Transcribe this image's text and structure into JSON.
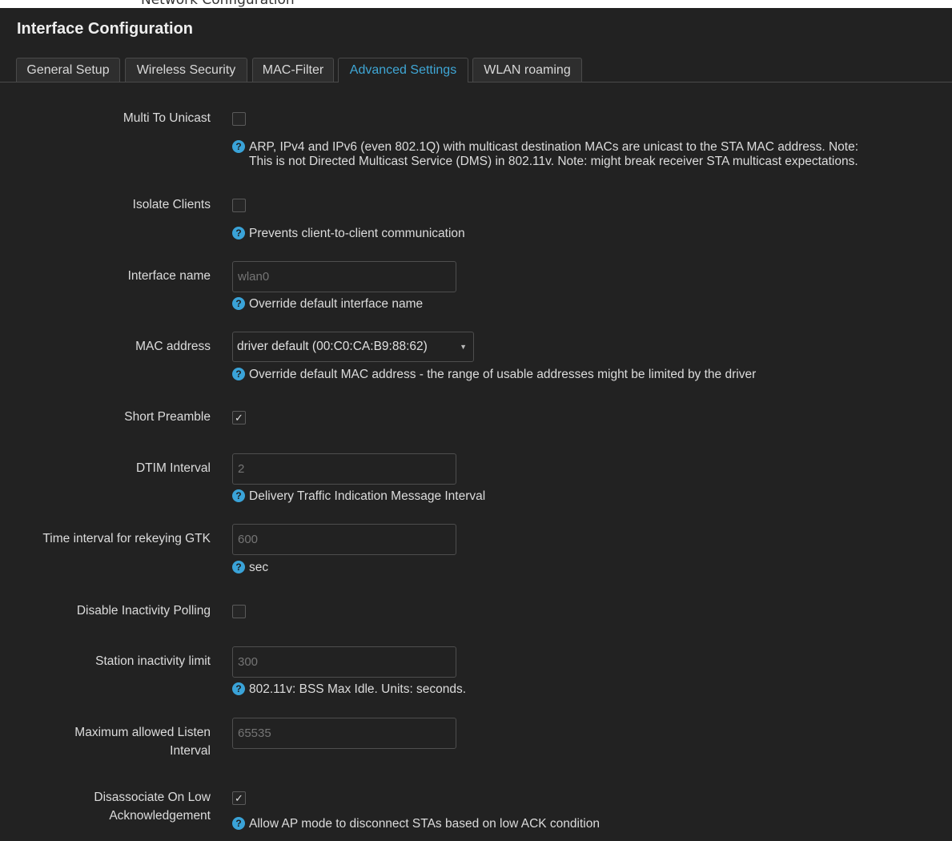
{
  "page": {
    "title": "Interface Configuration",
    "top_clip_text": "Network   Configuration"
  },
  "tabs": [
    {
      "label": "General Setup",
      "active": false
    },
    {
      "label": "Wireless Security",
      "active": false
    },
    {
      "label": "MAC-Filter",
      "active": false
    },
    {
      "label": "Advanced Settings",
      "active": true
    },
    {
      "label": "WLAN roaming",
      "active": false
    }
  ],
  "fields": {
    "multi_to_unicast": {
      "label": "Multi To Unicast",
      "checked": false,
      "help_line1": "ARP, IPv4 and IPv6 (even 802.1Q) with multicast destination MACs are unicast to the STA MAC address. Note:",
      "help_line2": "This is not Directed Multicast Service (DMS) in 802.11v. Note: might break receiver STA multicast expectations."
    },
    "isolate_clients": {
      "label": "Isolate Clients",
      "checked": false,
      "help": "Prevents client-to-client communication"
    },
    "interface_name": {
      "label": "Interface name",
      "placeholder": "wlan0",
      "value": "",
      "help": "Override default interface name"
    },
    "mac_address": {
      "label": "MAC address",
      "selected": "driver default (00:C0:CA:B9:88:62)",
      "help": "Override default MAC address - the range of usable addresses might be limited by the driver"
    },
    "short_preamble": {
      "label": "Short Preamble",
      "checked": true
    },
    "dtim_interval": {
      "label": "DTIM Interval",
      "placeholder": "2",
      "value": "",
      "help": "Delivery Traffic Indication Message Interval"
    },
    "rekey_gtk": {
      "label": "Time interval for rekeying GTK",
      "placeholder": "600",
      "value": "",
      "help": "sec"
    },
    "disable_inactivity_polling": {
      "label": "Disable Inactivity Polling",
      "checked": false
    },
    "station_inactivity_limit": {
      "label": "Station inactivity limit",
      "placeholder": "300",
      "value": "",
      "help": "802.11v: BSS Max Idle. Units: seconds."
    },
    "max_listen_interval": {
      "label_line1": "Maximum allowed Listen",
      "label_line2": "Interval",
      "placeholder": "65535",
      "value": ""
    },
    "disassoc_low_ack": {
      "label_line1": "Disassociate On Low",
      "label_line2": "Acknowledgement",
      "checked": true,
      "help": "Allow AP mode to disconnect STAs based on low ACK condition"
    }
  },
  "icons": {
    "help": "question-circle-icon",
    "check": "checkmark-icon",
    "caret": "caret-down-icon"
  },
  "colors": {
    "background": "#222222",
    "accent": "#3fa7d6",
    "help_icon": "#3aa3d8"
  }
}
